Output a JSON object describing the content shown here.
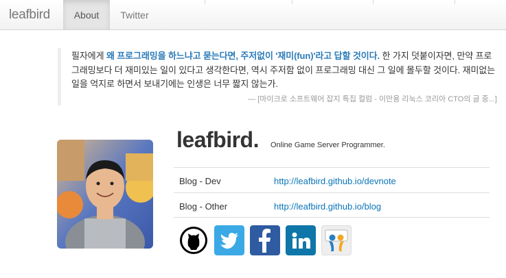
{
  "navbar": {
    "brand": "leafbird",
    "tabs": [
      {
        "label": "About",
        "active": true
      },
      {
        "label": "Twitter",
        "active": false
      }
    ]
  },
  "quote": {
    "prefix": "필자에게 ",
    "highlight": "왜 프로그래밍을 하느냐고 묻는다면, 주저없이 '재미(fun)'라고 답할 것이다.",
    "rest": " 한 가지 덧붙이자면, 만약 프로그래밍보다 더 재미있는 일이 있다고 생각한다면, 역시 주저함 없이 프로그래밍 대신 그 일에 몰두할 것이다. 재미없는 일을 억지로 하면서 보내기에는 인생은 너무 짧지 않는가.",
    "source": "— [마이크로 소프트웨어 잡지 특집 컬럼 - 이만용 리눅스 코리아 CTO의 글 중...]"
  },
  "profile": {
    "name": "leafbird.",
    "role": "Online Game Server Programmer."
  },
  "links": [
    {
      "label": "Blog - Dev",
      "url": "http://leafbird.github.io/devnote"
    },
    {
      "label": "Blog - Other",
      "url": "http://leafbird.github.io/blog"
    }
  ],
  "socials": [
    {
      "icon": "github-icon",
      "color": "#000000"
    },
    {
      "icon": "twitter-icon",
      "color": "#3ba9e6"
    },
    {
      "icon": "facebook-icon",
      "color": "#2f5ba0"
    },
    {
      "icon": "linkedin-icon",
      "color": "#0e76a8"
    },
    {
      "icon": "slideshare-icon",
      "color": "#f5a623"
    }
  ]
}
